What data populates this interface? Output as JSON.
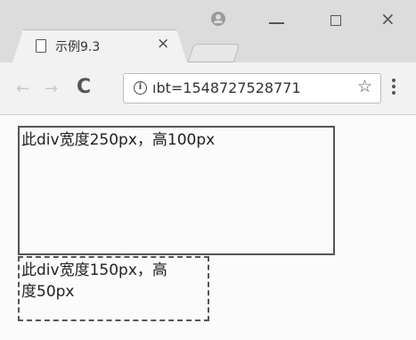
{
  "tab": {
    "title": "示例9.3",
    "close_label": "×"
  },
  "window": {
    "minimize": "—",
    "maximize": "",
    "close": "×"
  },
  "toolbar": {
    "back": "←",
    "forward": "→",
    "reload": "C",
    "info": "i",
    "url": "ıbt=1548727528771",
    "star": "☆"
  },
  "content": {
    "box1_text": "此div宽度250px，高100px",
    "box2_line1": "此div宽度150px，高",
    "box2_line2": "度50px"
  }
}
